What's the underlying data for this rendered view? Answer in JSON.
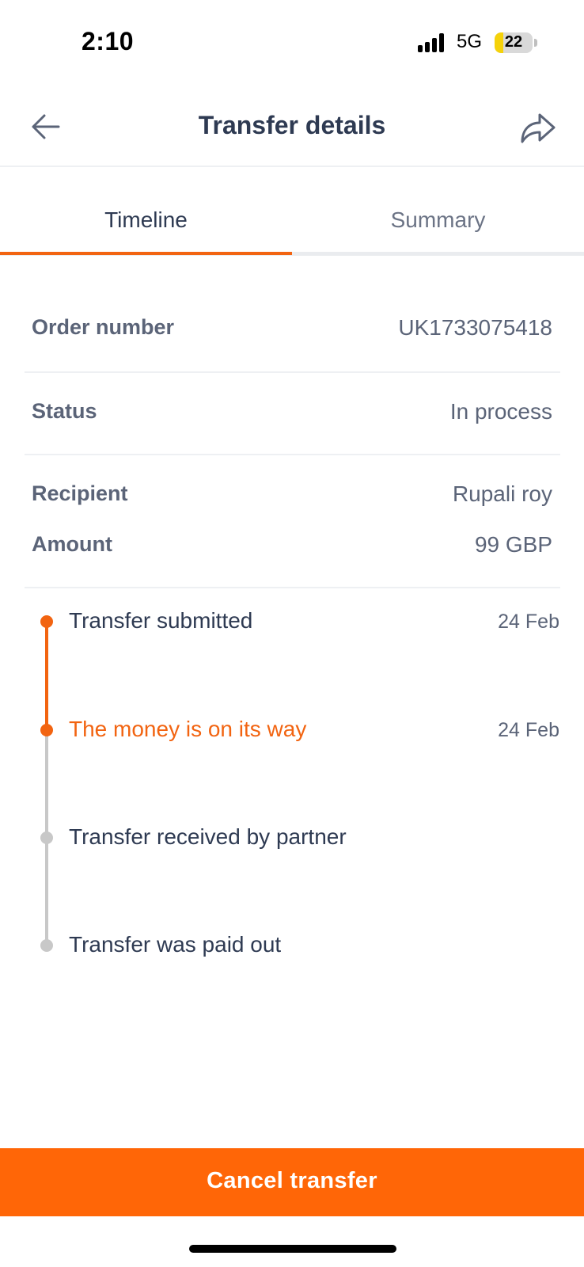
{
  "status_bar": {
    "time": "2:10",
    "network": "5G",
    "battery": "22",
    "battery_level": 0.22
  },
  "header": {
    "title": "Transfer details",
    "back_icon": "arrow-left-icon",
    "share_icon": "share-icon"
  },
  "tabs": [
    {
      "label": "Timeline",
      "active": true
    },
    {
      "label": "Summary",
      "active": false
    }
  ],
  "details": {
    "order": {
      "label": "Order number",
      "value": "UK1733075418"
    },
    "status": {
      "label": "Status",
      "value": "In process"
    },
    "recipient": {
      "label": "Recipient",
      "value": "Rupali roy"
    },
    "amount": {
      "label": "Amount",
      "value": "99 GBP"
    }
  },
  "timeline": [
    {
      "label": "Transfer submitted",
      "date": "24 Feb",
      "state": "done"
    },
    {
      "label": "The money is on its way",
      "date": "24 Feb",
      "state": "current"
    },
    {
      "label": "Transfer received by partner",
      "date": "",
      "state": "pending"
    },
    {
      "label": "Transfer was paid out",
      "date": "",
      "state": "pending"
    }
  ],
  "actions": {
    "cancel_label": "Cancel transfer"
  },
  "colors": {
    "accent": "#f26411",
    "button": "#ff6607",
    "text_primary": "#2e3a52",
    "text_secondary": "#5b6478",
    "pending": "#c8c8c8"
  }
}
